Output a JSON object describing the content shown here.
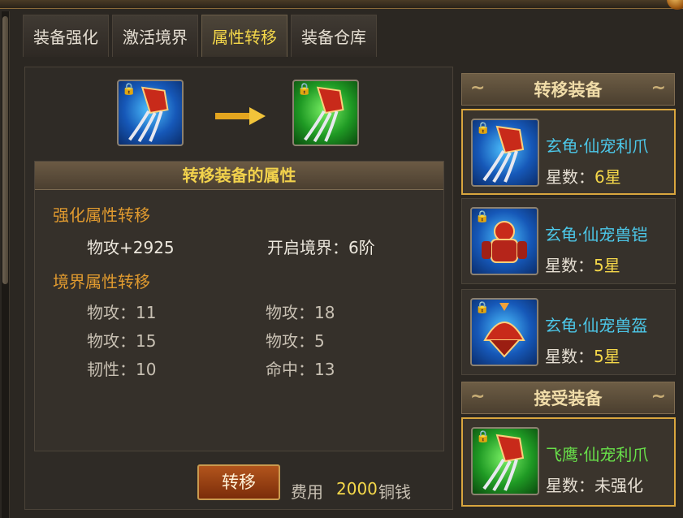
{
  "tabs": [
    {
      "label": "装备强化"
    },
    {
      "label": "激活境界"
    },
    {
      "label": "属性转移"
    },
    {
      "label": "装备仓库"
    }
  ],
  "active_tab": "属性转移",
  "transfer": {
    "source_icon": "claw-equipment-icon",
    "target_icon": "claw-equipment-icon",
    "arrow_icon": "right-arrow-icon"
  },
  "attributes": {
    "title": "转移装备的属性",
    "enhance_section": "强化属性转移",
    "enhance_attack": "物攻+2925",
    "realm_open": "开启境界：6阶",
    "realm_section": "境界属性转移",
    "realm_attrs": [
      "物攻：11",
      "物攻：18",
      "物攻：15",
      "物攻：5",
      "韧性：10",
      "命中：13"
    ]
  },
  "action": {
    "button_label": "转移",
    "cost_label": "费用",
    "cost_value": "2000",
    "cost_unit": "铜钱"
  },
  "side": {
    "source_header": "转移装备",
    "target_header": "接受装备",
    "source_items": [
      {
        "name": "玄龟·仙宠利爪",
        "stars_label": "星数：",
        "stars_value": "6星",
        "icon": "claw-icon"
      },
      {
        "name": "玄龟·仙宠兽铠",
        "stars_label": "星数：",
        "stars_value": "5星",
        "icon": "armor-icon"
      },
      {
        "name": "玄龟·仙宠兽盔",
        "stars_label": "星数：",
        "stars_value": "5星",
        "icon": "helmet-icon"
      }
    ],
    "target_item": {
      "name": "飞鹰·仙宠利爪",
      "stars_label": "星数：",
      "stars_value": "未强化",
      "icon": "claw-icon"
    }
  },
  "colors": {
    "accent_gold": "#f5d84a",
    "section_orange": "#e09a2f",
    "name_blue": "#4cc7e8",
    "name_green": "#68e04a"
  }
}
